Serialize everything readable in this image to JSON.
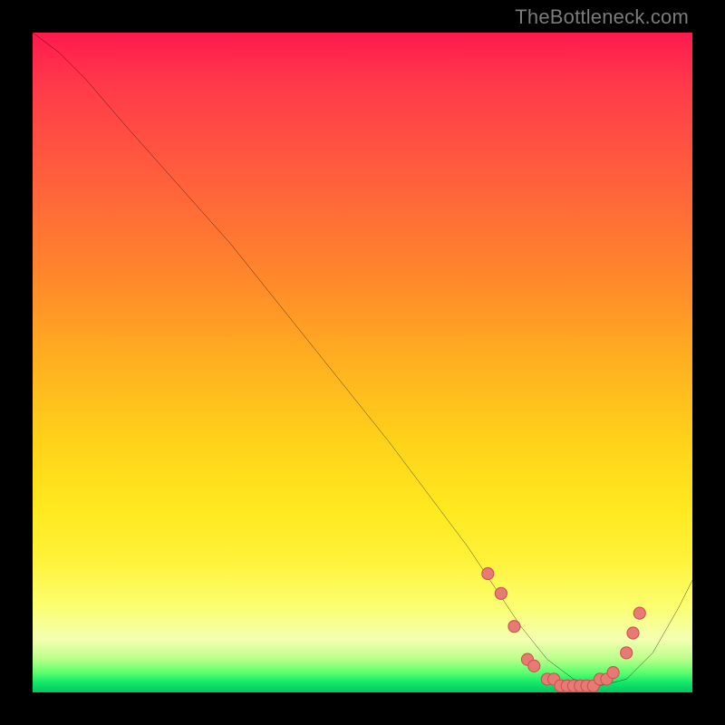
{
  "watermark": "TheBottleneck.com",
  "colors": {
    "frame": "#000000",
    "curve": "#000000",
    "dot_fill": "#e77a74",
    "dot_stroke": "#d0524c"
  },
  "chart_data": {
    "type": "line",
    "title": "",
    "xlabel": "",
    "ylabel": "",
    "xlim": [
      0,
      100
    ],
    "ylim": [
      0,
      100
    ],
    "series": [
      {
        "name": "bottleneck-curve",
        "x": [
          0,
          4,
          8,
          14,
          22,
          30,
          38,
          46,
          54,
          60,
          66,
          70,
          74,
          78,
          82,
          86,
          90,
          94,
          98,
          100
        ],
        "values": [
          100,
          97,
          93,
          86,
          77,
          68,
          58,
          48,
          38,
          30,
          22,
          16,
          10,
          5,
          2,
          1,
          2,
          6,
          13,
          17
        ]
      }
    ],
    "dots": {
      "name": "highlight-points",
      "x": [
        69,
        71,
        73,
        75,
        76,
        78,
        79,
        80,
        81,
        82,
        83,
        84,
        85,
        86,
        87,
        88,
        90,
        91,
        92
      ],
      "values": [
        18,
        15,
        10,
        5,
        4,
        2,
        2,
        1,
        1,
        1,
        1,
        1,
        1,
        2,
        2,
        3,
        6,
        9,
        12
      ]
    },
    "gradient_stops": [
      {
        "pct": 0,
        "color": "#ff1a4d"
      },
      {
        "pct": 38,
        "color": "#ff8a2a"
      },
      {
        "pct": 72,
        "color": "#ffe81f"
      },
      {
        "pct": 95,
        "color": "#b8ff8a"
      },
      {
        "pct": 100,
        "color": "#00c861"
      }
    ]
  }
}
